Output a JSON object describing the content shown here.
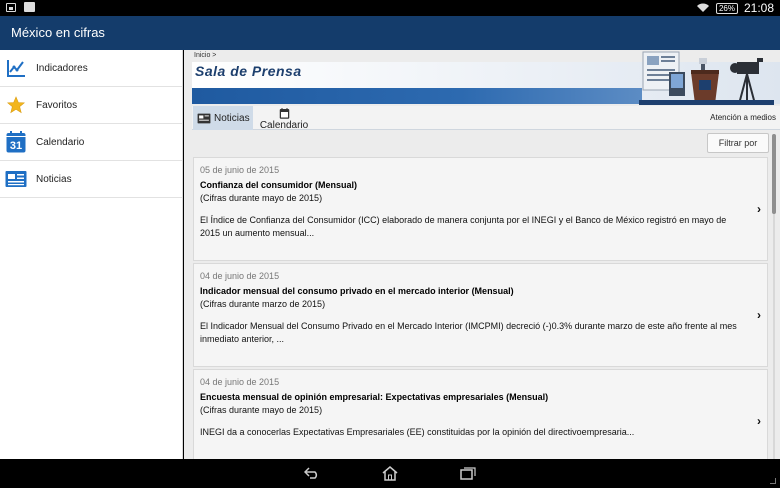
{
  "status_bar": {
    "time": "21:08",
    "battery": "26%"
  },
  "app_bar": {
    "title": "México en cifras"
  },
  "sidebar": {
    "items": [
      {
        "label": "Indicadores",
        "icon": "chart-icon"
      },
      {
        "label": "Favoritos",
        "icon": "star-icon"
      },
      {
        "label": "Calendario",
        "icon": "calendar-31-icon",
        "icon_text": "31"
      },
      {
        "label": "Noticias",
        "icon": "newspaper-icon"
      }
    ]
  },
  "main": {
    "breadcrumb": "Inicio >",
    "banner_title": "Sala de Prensa",
    "tabs": [
      {
        "label": "Noticias",
        "icon": "newspaper-icon",
        "selected": true
      },
      {
        "label": "Calendario",
        "icon": "calendar-icon",
        "selected": false
      }
    ],
    "media_link": "Atención a medios",
    "filter_label": "Filtrar por",
    "news": [
      {
        "date": "05 de junio de 2015",
        "title": "Confianza del consumidor (Mensual)",
        "subtitle": "(Cifras durante mayo de 2015)",
        "body": "El Índice de Confianza del Consumidor (ICC) elaborado de manera conjunta por el INEGI y el Banco de México registró en mayo de 2015 un aumento mensual..."
      },
      {
        "date": "04 de junio de 2015",
        "title": "Indicador mensual del consumo privado en el mercado interior (Mensual)",
        "subtitle": "(Cifras durante marzo de 2015)",
        "body": "El Indicador Mensual del Consumo Privado en el Mercado Interior (IMCPMI) decreció (-)0.3% durante marzo de este año frente al mes inmediato anterior, ..."
      },
      {
        "date": "04 de junio de 2015",
        "title": "Encuesta mensual de opinión empresarial: Expectativas empresariales (Mensual)",
        "subtitle": "(Cifras durante mayo de 2015)",
        "body": "INEGI da a conocerlas Expectativas Empresariales (EE) constituidas por la opinión del directivoempresaria..."
      }
    ]
  },
  "colors": {
    "app_bar": "#143c6b",
    "banner_strip": "#1f5aa0",
    "tab_selected": "#cfdbe8",
    "icon_blue": "#1f6fc4",
    "star": "#f2b51c"
  }
}
